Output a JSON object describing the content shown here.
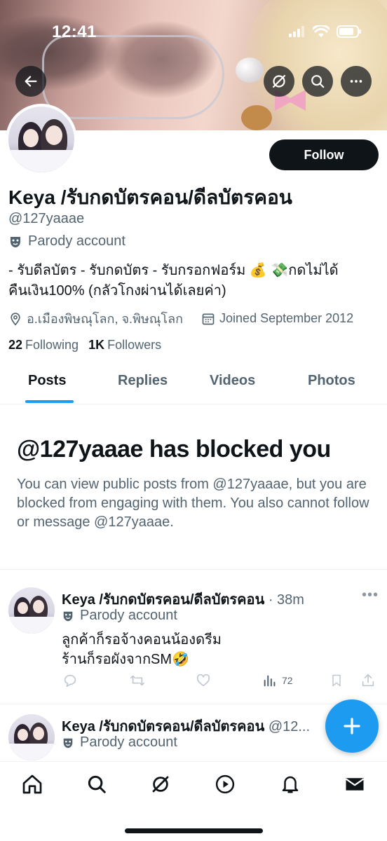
{
  "status_bar": {
    "time": "12:41"
  },
  "profile": {
    "display_name": "Keya /รับกดบัตรคอน/ดีลบัตรคอน",
    "handle": "@127yaaae",
    "parody_label": "Parody account",
    "bio_line1": "- รับดีลบัตร - รับกดบัตร - รับกรอกฟอร์ม 💰 💸กดไม่ได้",
    "bio_line2": "คืนเงิน100% (กลัวโกงผ่านได้เลยค่า)",
    "location": "อ.เมืองพิษณุโลก, จ.พิษณุโลก",
    "joined": "Joined September 2012",
    "following_count": "22",
    "following_label": "Following",
    "followers_count": "1K",
    "followers_label": "Followers",
    "follow_button": "Follow"
  },
  "tabs": [
    "Posts",
    "Replies",
    "Videos",
    "Photos"
  ],
  "blocked": {
    "title": "@127yaaae has blocked you",
    "message": "You can view public posts from @127yaaae, but you are blocked from engaging with them. You also cannot follow or message @127yaaae."
  },
  "tweets": [
    {
      "name": "Keya /รับกดบัตรคอน/ดีลบัตรคอน",
      "time": "· 38m",
      "parody_label": "Parody account",
      "text_line1": "ลูกค้าก็รอจ้างคอนน้องดรีม",
      "text_line2": "ร้านก็รอผังจากSM🤣",
      "views": "72"
    },
    {
      "name": "Keya /รับกดบัตรคอน/ดีลบัตรคอน",
      "time": "@12...",
      "parody_label": "Parody account"
    }
  ],
  "icons": {
    "back": "arrow-left-icon",
    "grok": "grok-icon",
    "search": "search-icon",
    "more": "more-icon",
    "compose": "plus-icon"
  },
  "colors": {
    "accent": "#1d9bf0",
    "text": "#0f1419",
    "muted": "#536471"
  }
}
